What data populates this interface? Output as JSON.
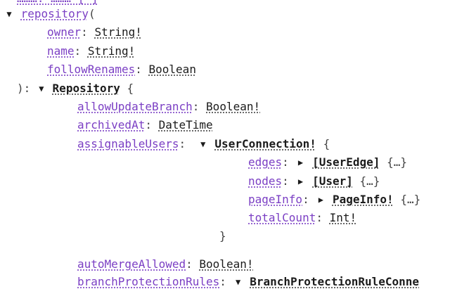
{
  "top_clipped": "………: ……… [ ]",
  "query": {
    "field": "repository",
    "open_paren": "(",
    "args": [
      {
        "name": "owner",
        "type": "String!"
      },
      {
        "name": "name",
        "type": "String!"
      },
      {
        "name": "followRenames",
        "type": "Boolean"
      }
    ],
    "close": "):",
    "return_type": "Repository",
    "open_brace": "{"
  },
  "repository_fields": {
    "allowUpdateBranch": {
      "name": "allowUpdateBranch",
      "type": "Boolean!"
    },
    "archivedAt": {
      "name": "archivedAt",
      "type": "DateTime"
    },
    "assignableUsers": {
      "name": "assignableUsers",
      "type": "UserConnection!",
      "open_brace": "{"
    },
    "autoMergeAllowed": {
      "name": "autoMergeAllowed",
      "type": "Boolean!"
    },
    "branchProtectionRules": {
      "name": "branchProtectionRules",
      "type": "BranchProtectionRuleConne"
    }
  },
  "user_connection_fields": [
    {
      "name": "edges",
      "type": "[UserEdge]",
      "collapsed": "{…}"
    },
    {
      "name": "nodes",
      "type": "[User]",
      "collapsed": "{…}"
    },
    {
      "name": "pageInfo",
      "type": "PageInfo!",
      "collapsed": "{…}"
    },
    {
      "name": "totalCount",
      "type": "Int!"
    }
  ],
  "close_brace": "}",
  "colon": ":",
  "icons": {
    "expanded": "▼",
    "collapsed": "▶"
  }
}
